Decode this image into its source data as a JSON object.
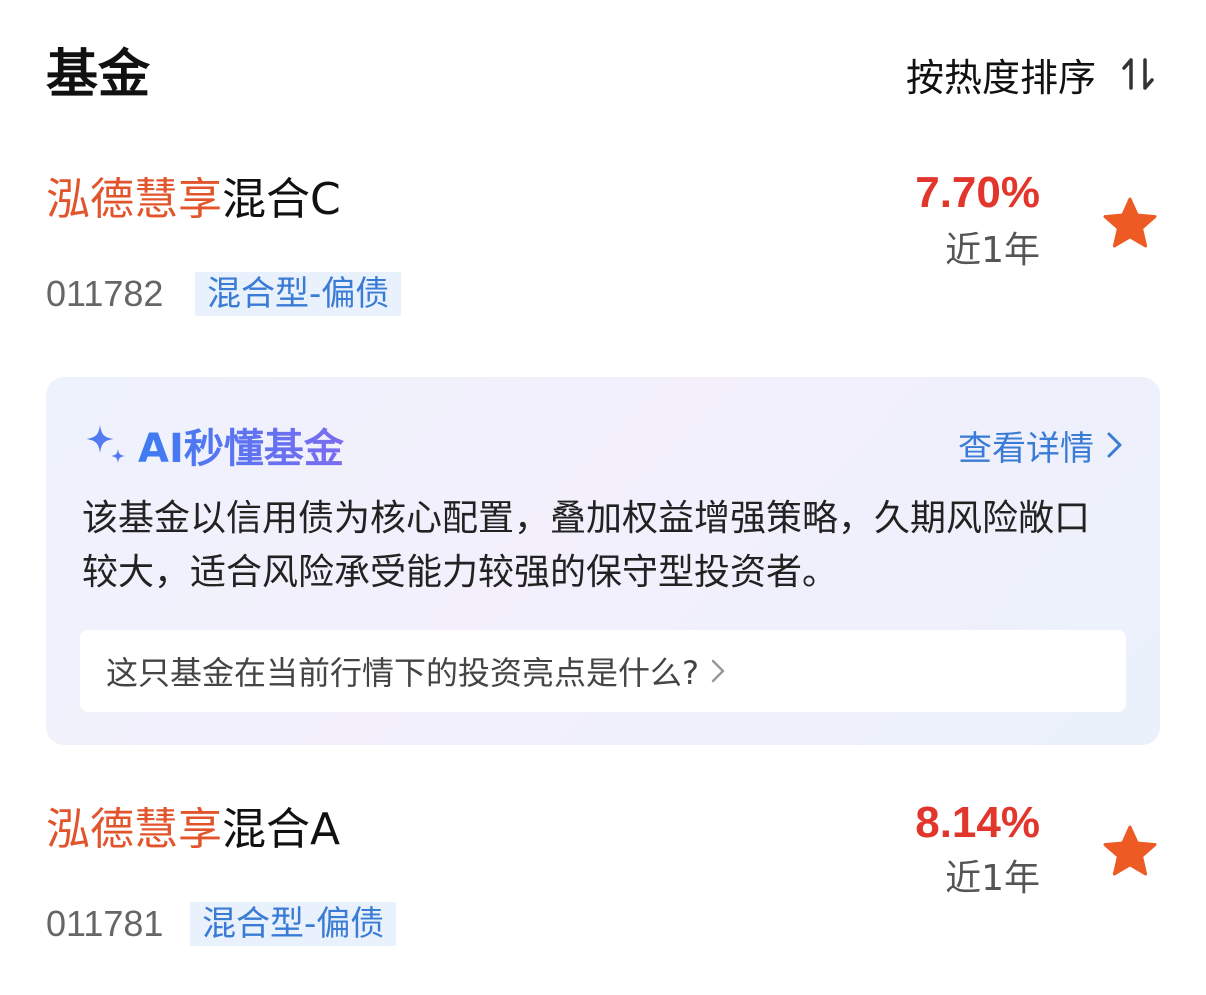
{
  "header": {
    "title": "基金",
    "sort_label": "按热度排序",
    "sort_icon": "sort-arrows-icon"
  },
  "funds": [
    {
      "name_highlight": "泓德慧享",
      "name_rest": "混合C",
      "code": "011782",
      "tag": "混合型-偏债",
      "return": "7.70%",
      "period": "近1年",
      "favorited": true
    },
    {
      "name_highlight": "泓德慧享",
      "name_rest": "混合A",
      "code": "011781",
      "tag": "混合型-偏债",
      "return": "8.14%",
      "period": "近1年",
      "favorited": true
    }
  ],
  "ai_card": {
    "title": "AI秒懂基金",
    "detail_label": "查看详情",
    "summary": "该基金以信用债为核心配置，叠加权益增强策略，久期风险敞口较大，适合风险承受能力较强的保守型投资者。",
    "question": "这只基金在当前行情下的投资亮点是什么?"
  },
  "colors": {
    "highlight": "#e2552c",
    "return": "#e2362c",
    "star": "#ee5a24",
    "link": "#3a7bd5",
    "tag_bg": "#e8f1fc"
  }
}
